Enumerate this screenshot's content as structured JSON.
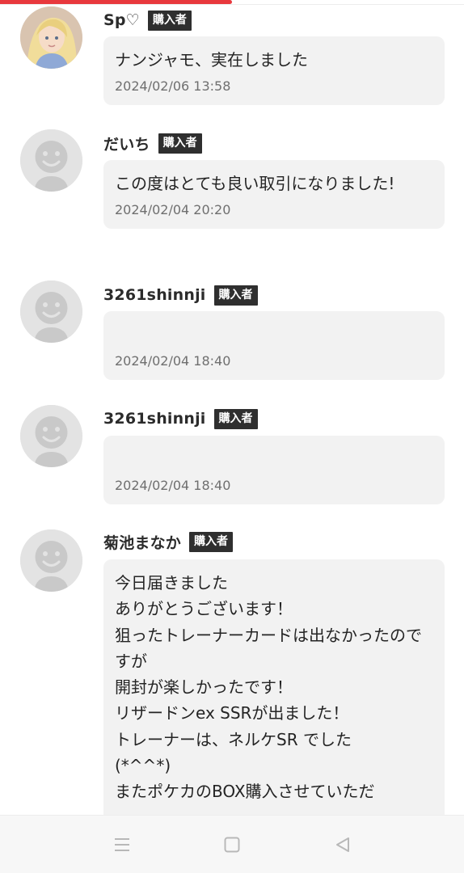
{
  "progress": {
    "fraction": 0.5,
    "color": "#e8383d"
  },
  "buyer_badge_label": "購入者",
  "comments": [
    {
      "name": "Sp♡",
      "message": "ナンジャモ、実在しました",
      "timestamp": "2024/02/06 13:58",
      "avatar": "illustrated-avatar"
    },
    {
      "name": "だいち",
      "message": "この度はとても良い取引になりました!",
      "timestamp": "2024/02/04 20:20",
      "avatar": "default-avatar"
    },
    {
      "name": "3261shinnji",
      "message": "",
      "timestamp": "2024/02/04 18:40",
      "avatar": "default-avatar"
    },
    {
      "name": "3261shinnji",
      "message": "",
      "timestamp": "2024/02/04 18:40",
      "avatar": "default-avatar"
    },
    {
      "name": "菊池まなか",
      "message": "今日届きました\nありがとうございます！\n狙ったトレーナーカードは出なかったのですが\n開封が楽しかったです！\nリザードンex SSRが出ました！\nトレーナーは、ネルケSR でした\n(*^^*)\nまたポケカのBOX購入させていただ",
      "timestamp": "",
      "avatar": "default-avatar"
    }
  ],
  "nav": {
    "menu_icon": "menu-icon",
    "home_icon": "home-square-icon",
    "back_icon": "back-triangle-icon"
  }
}
